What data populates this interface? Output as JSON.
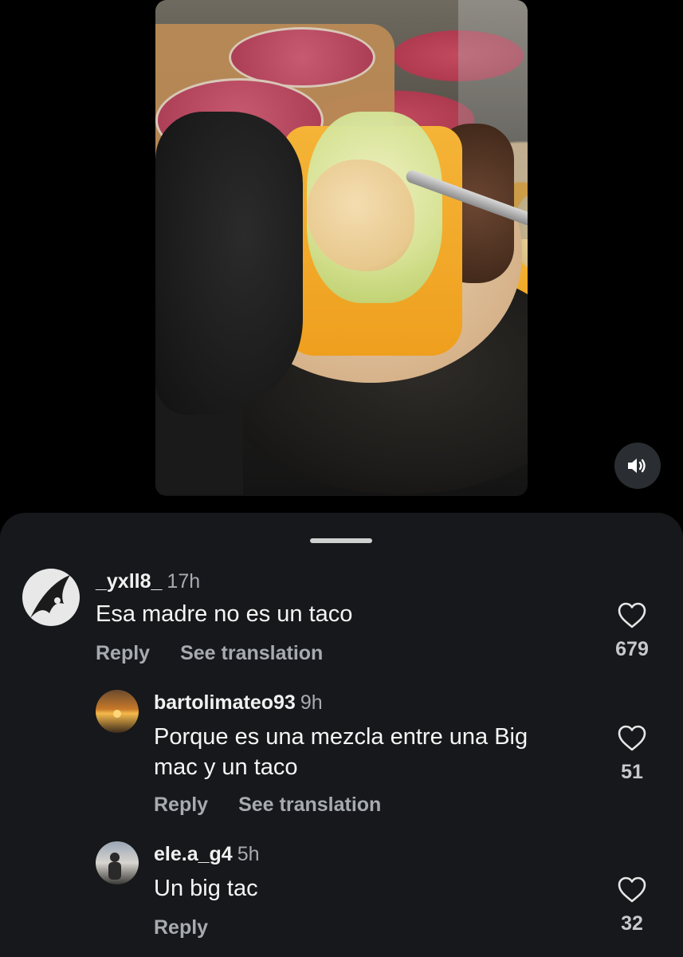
{
  "video": {
    "volume_icon": "speaker-icon"
  },
  "comments": [
    {
      "username": "_yxll8_",
      "time": "17h",
      "text": "Esa madre no es un taco",
      "reply_label": "Reply",
      "translate_label": "See translation",
      "likes": "679"
    },
    {
      "username": "bartolimateo93",
      "time": "9h",
      "text_line1": "Porque es una mezcla entre una Big",
      "text_line2": "mac y un taco",
      "reply_label": "Reply",
      "translate_label": "See translation",
      "likes": "51"
    },
    {
      "username": "ele.a_g4",
      "time": "5h",
      "text": "Un big tac",
      "reply_label": "Reply",
      "likes": "32"
    }
  ],
  "colors": {
    "sheet_bg": "#16181b",
    "secondary_text": "#a7abb0"
  }
}
